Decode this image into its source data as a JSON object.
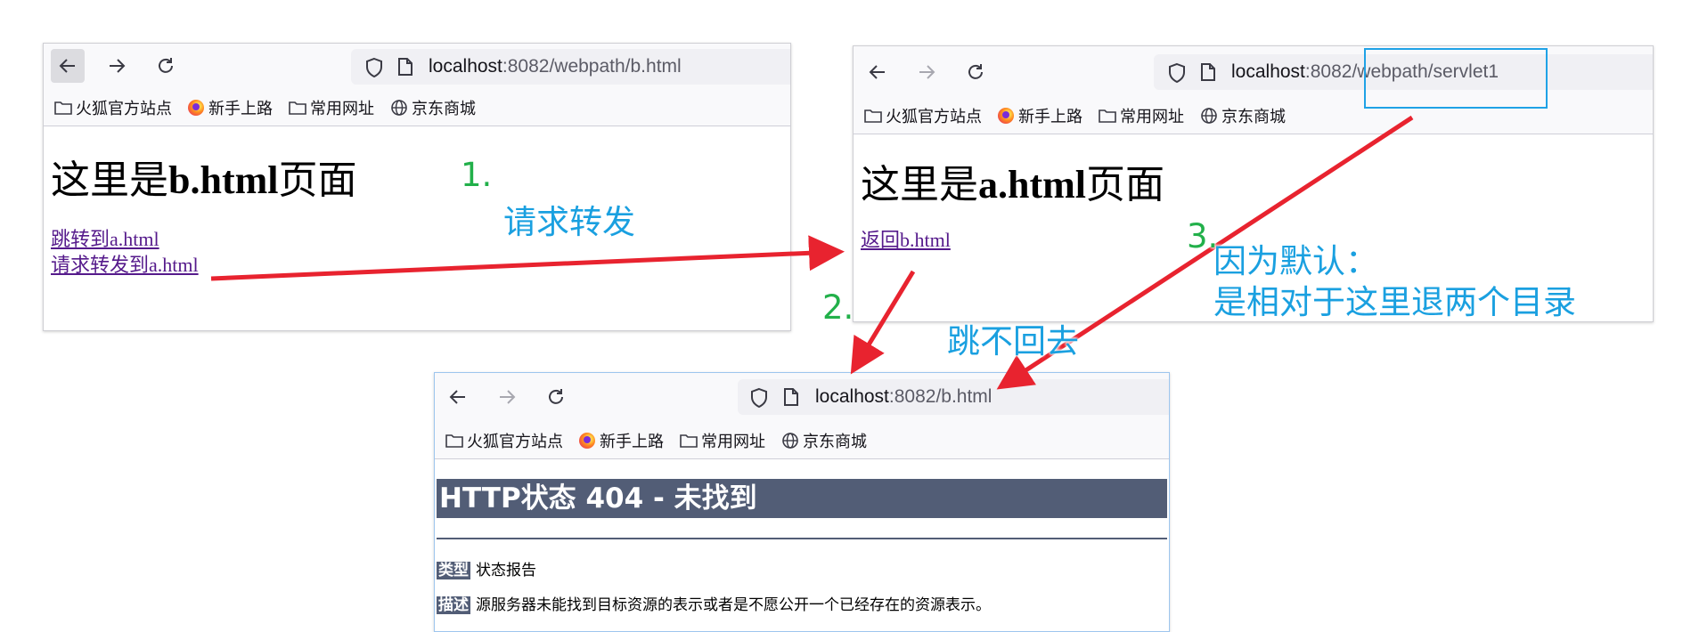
{
  "windows": [
    {
      "url_host": "localhost",
      "url_path": ":8082/webpath/b.html",
      "bookmarks": [
        "火狐官方站点",
        "新手上路",
        "常用网址",
        "京东商城"
      ],
      "heading_prefix": "这里是",
      "heading_bold": "b.html",
      "heading_suffix": "页面",
      "links": [
        "跳转到a.html",
        "请求转发到a.html"
      ]
    },
    {
      "url_host": "localhost",
      "url_path": ":8082/webpath/servlet1",
      "bookmarks": [
        "火狐官方站点",
        "新手上路",
        "常用网址",
        "京东商城"
      ],
      "heading_prefix": "这里是",
      "heading_bold": "a.html",
      "heading_suffix": "页面",
      "links": [
        "返回b.html"
      ]
    },
    {
      "url_host": "localhost",
      "url_path": ":8082/b.html",
      "bookmarks": [
        "火狐官方站点",
        "新手上路",
        "常用网址",
        "京东商城"
      ],
      "error_title": "HTTP状态 404 - 未找到",
      "type_label": "类型",
      "type_value": "状态报告",
      "desc_label": "描述",
      "desc_value": "源服务器未能找到目标资源的表示或者是不愿公开一个已经存在的资源表示。"
    }
  ],
  "annotations": {
    "step1_number": "1.",
    "step1_text": "请求转发",
    "step2_number": "2.",
    "step2_text": "跳不回去",
    "step3_number": "3.",
    "step3_line1": "因为默认：",
    "step3_line2": "是相对于这里退两个目录"
  },
  "colors": {
    "arrow": "#e8232f",
    "annotation_blue": "#1aa0e0",
    "annotation_green": "#22b04a",
    "error_header": "#525d76",
    "link_visited": "#551a8b"
  }
}
